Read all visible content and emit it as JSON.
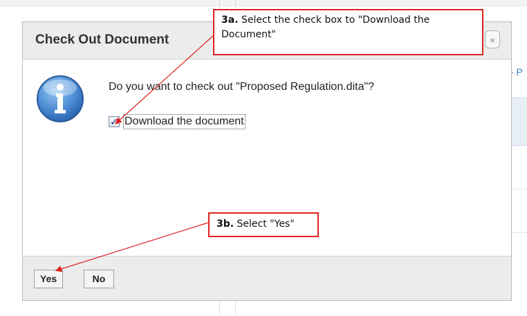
{
  "background": {
    "link_fragment": "- P"
  },
  "dialog": {
    "title": "Check Out Document",
    "close_glyph": "×",
    "icon": "info-icon",
    "question": "Do you want to check out \"Proposed Regulation.dita\"?",
    "checkbox": {
      "label": "Download the document",
      "checked": true
    },
    "buttons": {
      "yes": "Yes",
      "no": "No"
    }
  },
  "annotations": {
    "step_a": {
      "number": "3a.",
      "text": " Select the check box to \"Download the Document\""
    },
    "step_b": {
      "number": "3b.",
      "text": " Select \"Yes\""
    },
    "color": "#e02020"
  }
}
